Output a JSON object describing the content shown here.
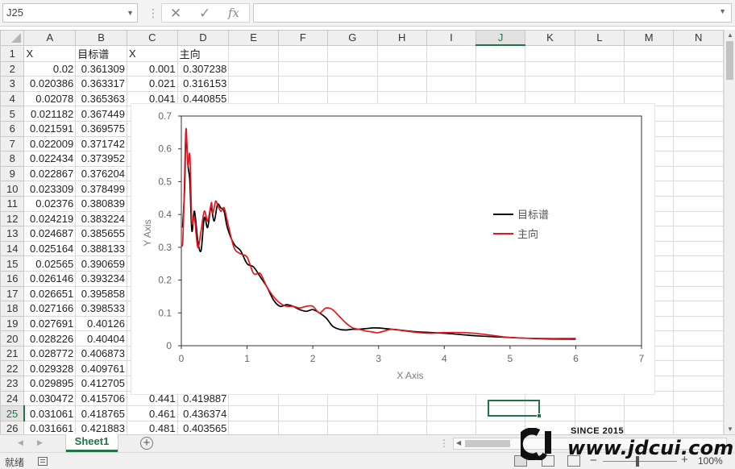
{
  "formula_bar": {
    "name_box": "J25",
    "cancel_icon": "✕",
    "enter_icon": "✓",
    "function_icon": "fx",
    "formula_value": ""
  },
  "columns": [
    "A",
    "B",
    "C",
    "D",
    "E",
    "F",
    "G",
    "H",
    "I",
    "J",
    "K",
    "L",
    "M",
    "N"
  ],
  "selected_column": "J",
  "selected_row": 25,
  "rows": [
    {
      "n": 1,
      "cells": [
        "X",
        "目标谱",
        "X",
        "主向"
      ]
    },
    {
      "n": 2,
      "cells": [
        "0.02",
        "0.361309",
        "0.001",
        "0.307238"
      ]
    },
    {
      "n": 3,
      "cells": [
        "0.020386",
        "0.363317",
        "0.021",
        "0.316153"
      ]
    },
    {
      "n": 4,
      "cells": [
        "0.02078",
        "0.365363",
        "0.041",
        "0.440855"
      ]
    },
    {
      "n": 5,
      "cells": [
        "0.021182",
        "0.367449",
        "",
        ""
      ]
    },
    {
      "n": 6,
      "cells": [
        "0.021591",
        "0.369575",
        "",
        ""
      ]
    },
    {
      "n": 7,
      "cells": [
        "0.022009",
        "0.371742",
        "",
        ""
      ]
    },
    {
      "n": 8,
      "cells": [
        "0.022434",
        "0.373952",
        "",
        ""
      ]
    },
    {
      "n": 9,
      "cells": [
        "0.022867",
        "0.376204",
        "",
        ""
      ]
    },
    {
      "n": 10,
      "cells": [
        "0.023309",
        "0.378499",
        "",
        ""
      ]
    },
    {
      "n": 11,
      "cells": [
        "0.02376",
        "0.380839",
        "",
        ""
      ]
    },
    {
      "n": 12,
      "cells": [
        "0.024219",
        "0.383224",
        "",
        ""
      ]
    },
    {
      "n": 13,
      "cells": [
        "0.024687",
        "0.385655",
        "",
        ""
      ]
    },
    {
      "n": 14,
      "cells": [
        "0.025164",
        "0.388133",
        "",
        ""
      ]
    },
    {
      "n": 15,
      "cells": [
        "0.02565",
        "0.390659",
        "",
        ""
      ]
    },
    {
      "n": 16,
      "cells": [
        "0.026146",
        "0.393234",
        "",
        ""
      ]
    },
    {
      "n": 17,
      "cells": [
        "0.026651",
        "0.395858",
        "",
        ""
      ]
    },
    {
      "n": 18,
      "cells": [
        "0.027166",
        "0.398533",
        "",
        ""
      ]
    },
    {
      "n": 19,
      "cells": [
        "0.027691",
        "0.40126",
        "",
        ""
      ]
    },
    {
      "n": 20,
      "cells": [
        "0.028226",
        "0.40404",
        "",
        ""
      ]
    },
    {
      "n": 21,
      "cells": [
        "0.028772",
        "0.406873",
        "",
        ""
      ]
    },
    {
      "n": 22,
      "cells": [
        "0.029328",
        "0.409761",
        "",
        ""
      ]
    },
    {
      "n": 23,
      "cells": [
        "0.029895",
        "0.412705",
        "",
        ""
      ]
    },
    {
      "n": 24,
      "cells": [
        "0.030472",
        "0.415706",
        "0.441",
        "0.419887"
      ]
    },
    {
      "n": 25,
      "cells": [
        "0.031061",
        "0.418765",
        "0.461",
        "0.436374"
      ]
    },
    {
      "n": 26,
      "cells": [
        "0.031661",
        "0.421883",
        "0.481",
        "0.403565"
      ]
    }
  ],
  "chart_data": {
    "type": "line",
    "title": "",
    "xlabel": "X Axis",
    "ylabel": "Y Axis",
    "xlim": [
      0,
      7
    ],
    "ylim": [
      0,
      0.7
    ],
    "xticks": [
      "0",
      "1",
      "2",
      "3",
      "4",
      "5",
      "6",
      "7"
    ],
    "yticks": [
      "0",
      "0.1",
      "0.2",
      "0.3",
      "0.4",
      "0.5",
      "0.6",
      "0.7"
    ],
    "grid": false,
    "legend_position": "right",
    "series": [
      {
        "name": "目标谱",
        "color": "#000000",
        "x": [
          0.02,
          0.05,
          0.07,
          0.1,
          0.13,
          0.16,
          0.2,
          0.25,
          0.3,
          0.35,
          0.4,
          0.45,
          0.5,
          0.55,
          0.6,
          0.65,
          0.7,
          0.8,
          0.9,
          1.0,
          1.1,
          1.2,
          1.3,
          1.4,
          1.5,
          1.6,
          1.7,
          1.8,
          1.9,
          2.0,
          2.1,
          2.2,
          2.3,
          2.4,
          2.5,
          2.6,
          2.7,
          2.8,
          2.9,
          3.0,
          3.2,
          3.4,
          3.6,
          3.8,
          4.0,
          4.2,
          4.5,
          5.0,
          5.5,
          6.0
        ],
        "y": [
          0.36,
          0.48,
          0.64,
          0.55,
          0.5,
          0.35,
          0.41,
          0.32,
          0.29,
          0.39,
          0.36,
          0.42,
          0.38,
          0.43,
          0.42,
          0.41,
          0.36,
          0.31,
          0.29,
          0.25,
          0.24,
          0.21,
          0.18,
          0.14,
          0.12,
          0.125,
          0.12,
          0.11,
          0.105,
          0.11,
          0.1,
          0.085,
          0.06,
          0.05,
          0.048,
          0.05,
          0.05,
          0.052,
          0.054,
          0.054,
          0.05,
          0.046,
          0.042,
          0.04,
          0.038,
          0.035,
          0.03,
          0.025,
          0.021,
          0.02
        ]
      },
      {
        "name": "主向",
        "color": "#e8141e",
        "x": [
          0.001,
          0.021,
          0.041,
          0.07,
          0.1,
          0.13,
          0.16,
          0.2,
          0.25,
          0.3,
          0.35,
          0.4,
          0.441,
          0.461,
          0.481,
          0.52,
          0.55,
          0.6,
          0.65,
          0.7,
          0.8,
          0.9,
          1.0,
          1.1,
          1.2,
          1.3,
          1.4,
          1.5,
          1.6,
          1.7,
          1.8,
          1.9,
          2.0,
          2.1,
          2.2,
          2.3,
          2.4,
          2.5,
          2.6,
          2.7,
          2.8,
          2.9,
          3.0,
          3.2,
          3.4,
          3.6,
          3.8,
          4.0,
          4.3,
          4.6,
          5.0,
          5.5,
          6.0
        ],
        "y": [
          0.307,
          0.316,
          0.441,
          0.66,
          0.55,
          0.58,
          0.38,
          0.39,
          0.3,
          0.35,
          0.41,
          0.38,
          0.42,
          0.436,
          0.404,
          0.44,
          0.43,
          0.41,
          0.42,
          0.38,
          0.3,
          0.28,
          0.27,
          0.22,
          0.22,
          0.18,
          0.15,
          0.13,
          0.12,
          0.12,
          0.115,
          0.12,
          0.12,
          0.1,
          0.115,
          0.11,
          0.09,
          0.07,
          0.055,
          0.05,
          0.045,
          0.042,
          0.04,
          0.05,
          0.045,
          0.04,
          0.038,
          0.04,
          0.04,
          0.035,
          0.025,
          0.022,
          0.022
        ]
      }
    ]
  },
  "sheet_tabs": [
    {
      "label": "Sheet1",
      "active": true
    }
  ],
  "add_sheet_icon": "+",
  "status_bar": {
    "ready_text": "就绪",
    "zoom_level": "100%",
    "zoom_minus": "−",
    "zoom_plus": "+"
  },
  "watermark": {
    "since_text": "SINCE 2015",
    "url_text": "www.jdcui.com"
  }
}
